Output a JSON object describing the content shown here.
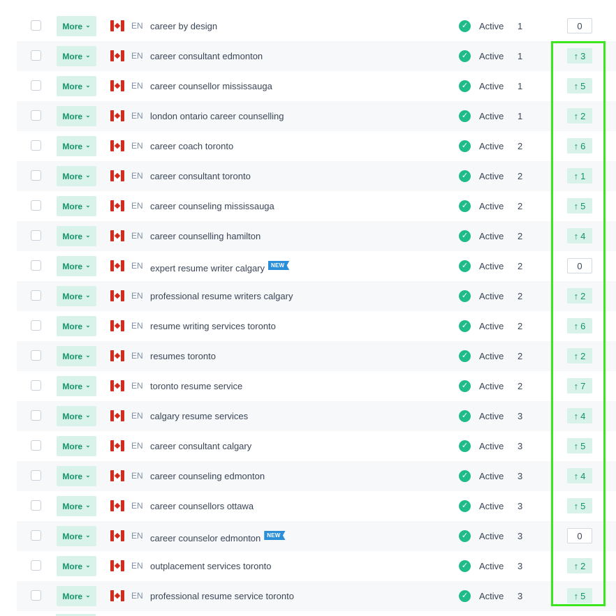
{
  "more_label": "More",
  "status_label": "Active",
  "new_badge": "NEW",
  "colors": {
    "accent": "#1fbc8a",
    "highlight": "#3ce61e",
    "badge": "#2a8fd8"
  },
  "rows": [
    {
      "lang": "EN",
      "keyword": "career by design",
      "position": "1",
      "change": "0",
      "direction": "none",
      "is_new": false
    },
    {
      "lang": "EN",
      "keyword": "career consultant edmonton",
      "position": "1",
      "change": "3",
      "direction": "up",
      "is_new": false
    },
    {
      "lang": "EN",
      "keyword": "career counsellor mississauga",
      "position": "1",
      "change": "5",
      "direction": "up",
      "is_new": false
    },
    {
      "lang": "EN",
      "keyword": "london ontario career counselling",
      "position": "1",
      "change": "2",
      "direction": "up",
      "is_new": false
    },
    {
      "lang": "EN",
      "keyword": "career coach toronto",
      "position": "2",
      "change": "6",
      "direction": "up",
      "is_new": false
    },
    {
      "lang": "EN",
      "keyword": "career consultant toronto",
      "position": "2",
      "change": "1",
      "direction": "up",
      "is_new": false
    },
    {
      "lang": "EN",
      "keyword": "career counseling mississauga",
      "position": "2",
      "change": "5",
      "direction": "up",
      "is_new": false
    },
    {
      "lang": "EN",
      "keyword": "career counselling hamilton",
      "position": "2",
      "change": "4",
      "direction": "up",
      "is_new": false
    },
    {
      "lang": "EN",
      "keyword": "expert resume writer calgary",
      "position": "2",
      "change": "0",
      "direction": "none",
      "is_new": true
    },
    {
      "lang": "EN",
      "keyword": "professional resume writers calgary",
      "position": "2",
      "change": "2",
      "direction": "up",
      "is_new": false
    },
    {
      "lang": "EN",
      "keyword": "resume writing services toronto",
      "position": "2",
      "change": "6",
      "direction": "up",
      "is_new": false
    },
    {
      "lang": "EN",
      "keyword": "resumes toronto",
      "position": "2",
      "change": "2",
      "direction": "up",
      "is_new": false
    },
    {
      "lang": "EN",
      "keyword": "toronto resume service",
      "position": "2",
      "change": "7",
      "direction": "up",
      "is_new": false
    },
    {
      "lang": "EN",
      "keyword": "calgary resume services",
      "position": "3",
      "change": "4",
      "direction": "up",
      "is_new": false
    },
    {
      "lang": "EN",
      "keyword": "career consultant calgary",
      "position": "3",
      "change": "5",
      "direction": "up",
      "is_new": false
    },
    {
      "lang": "EN",
      "keyword": "career counseling edmonton",
      "position": "3",
      "change": "4",
      "direction": "up",
      "is_new": false
    },
    {
      "lang": "EN",
      "keyword": "career counsellors ottawa",
      "position": "3",
      "change": "5",
      "direction": "up",
      "is_new": false
    },
    {
      "lang": "EN",
      "keyword": "career counselor edmonton",
      "position": "3",
      "change": "0",
      "direction": "none",
      "is_new": true
    },
    {
      "lang": "EN",
      "keyword": "outplacement services toronto",
      "position": "3",
      "change": "2",
      "direction": "up",
      "is_new": false
    },
    {
      "lang": "EN",
      "keyword": "professional resume service toronto",
      "position": "3",
      "change": "5",
      "direction": "up",
      "is_new": false
    }
  ]
}
